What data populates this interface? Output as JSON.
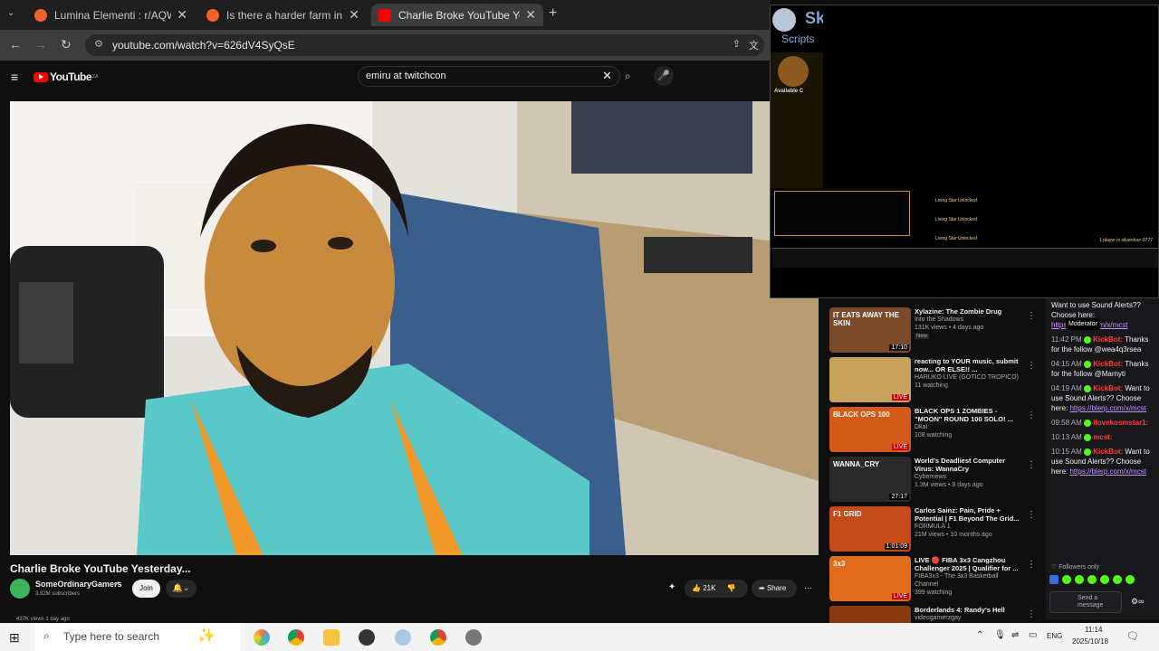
{
  "browser": {
    "tabs": [
      {
        "title": "Lumina Elementi : r/AQW",
        "close": "✕"
      },
      {
        "title": "Is there a harder farm in the game",
        "close": "✕"
      },
      {
        "title": "Charlie Broke YouTube Yesterday",
        "close": "✕"
      }
    ],
    "new_tab": "+",
    "url": "youtube.com/watch?v=626dV4SyQsE"
  },
  "youtube": {
    "logo": "YouTube",
    "logo_suffix": "ZA",
    "search_value": "emiru at twitchcon",
    "video_title": "Charlie Broke YouTube Yesterday...",
    "channel": "SomeOrdinaryGamers",
    "subscribers": "3.92M subscribers",
    "join_label": "Join",
    "likes": "21K",
    "share_label": "Share",
    "views_line": "437K views  1 day ago"
  },
  "overlay": {
    "scripts_label": "Scripts",
    "sk_label": "Sk",
    "available": "Available C",
    "items": [
      "Living Star Unlocked",
      "Living Star Unlocked",
      "Living Star Unlocked"
    ],
    "status": "1 player in silverdoor-9777"
  },
  "recommendations": [
    {
      "title": "Xylazine: The Zombie Drug",
      "channel": "Into the Shadows",
      "meta": "131K views • 4 days ago",
      "badge": "New",
      "duration": "17:10",
      "thumb_text": "IT EATS AWAY THE SKIN"
    },
    {
      "title": "reacting to YOUR music, submit now... OR ELSE!! ...",
      "channel": "HARUKO LIVE (GOTICO TROPICO)",
      "meta": "11 watching",
      "badge": "",
      "duration": "LIVE",
      "thumb_text": ""
    },
    {
      "title": "BLACK OPS 1 ZOMBIES - \"MOON\" ROUND 100 SOLO! ...",
      "channel": "Dkal",
      "meta": "108 watching",
      "badge": "",
      "duration": "LIVE",
      "thumb_text": "BLACK OPS 100"
    },
    {
      "title": "World's Deadliest Computer Virus: WannaCry",
      "channel": "Cybernews",
      "meta": "1.3M views • 9 days ago",
      "badge": "",
      "duration": "27:17",
      "thumb_text": "WANNA_CRY"
    },
    {
      "title": "Carlos Sainz: Pain, Pride + Potential | F1 Beyond The Grid...",
      "channel": "FORMULA 1",
      "meta": "21M views • 10 months ago",
      "badge": "",
      "duration": "1:01:09",
      "thumb_text": "F1 GRID"
    },
    {
      "title": "LIVE 🔴 FIBA 3x3 Cangzhou Challenger 2025 | Qualifier for ...",
      "channel": "FIBA3x3 - The 3x3 Basketball Channel",
      "meta": "399 watching",
      "badge": "",
      "duration": "LIVE",
      "thumb_text": "3x3"
    },
    {
      "title": "Borderlands 4: Randy's Hell",
      "channel": "videogamerzgay",
      "meta": "",
      "badge": "",
      "duration": "",
      "thumb_text": ""
    }
  ],
  "chat": {
    "messages": [
      {
        "time": "",
        "user": "",
        "text": "Want to use Sound Alerts?? Choose here:",
        "link": "https://blerp.com/x/mcst"
      },
      {
        "time": "11:42 PM",
        "user": "KickBot:",
        "text": "Thanks for the follow @wea4q3rsea",
        "link": ""
      },
      {
        "time": "04:15 AM",
        "user": "KickBot:",
        "text": "Thanks for the follow @Marnyti",
        "link": ""
      },
      {
        "time": "04:19 AM",
        "user": "KickBot:",
        "text": "Want to use Sound Alerts?? Choose here:",
        "link": "https://blerp.com/x/mcst"
      },
      {
        "time": "09:58 AM",
        "user": "ilovekosmstar1:",
        "text": "",
        "link": ""
      },
      {
        "time": "10:13 AM",
        "user": "mcst:",
        "text": "",
        "link": ""
      },
      {
        "time": "10:15 AM",
        "user": "KickBot:",
        "text": "Want to use Sound Alerts?? Choose here:",
        "link": "https://blerp.com/x/mcst"
      }
    ],
    "moderator_tooltip": "Moderator",
    "followers_only": "Followers only",
    "send_placeholder": "Send a message"
  },
  "taskbar": {
    "search_placeholder": "Type here to search",
    "lang": "ENG",
    "time": "11:14",
    "date": "2025/10/18"
  },
  "colors": {
    "youtube_red": "#ff0000",
    "kick_green": "#53fc18",
    "kickbot_red": "#ff3c3c",
    "twitch_link": "#bf94ff"
  }
}
